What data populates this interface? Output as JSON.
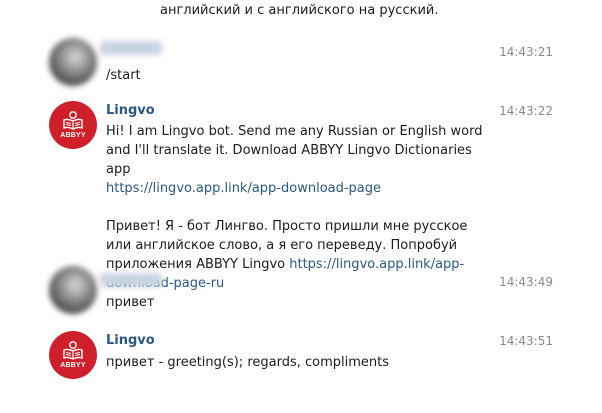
{
  "top_text": "английский и с английского на русский.",
  "messages": [
    {
      "sender": "",
      "time": "14:43:21",
      "text": "/start"
    },
    {
      "sender": "Lingvo",
      "avatar_label": "ABBYY",
      "time": "14:43:22",
      "en_text": "Hi! I am Lingvo bot. Send me any Russian or English word and I'll translate it. Download ABBYY Lingvo Dictionaries app",
      "en_link": "https://lingvo.app.link/app-download-page",
      "ru_text": "Привет! Я - бот Лингво. Просто пришли мне русское или английское слово, а я его переведу. Попробуй приложения ABBYY Lingvo",
      "ru_link": "https://lingvo.app.link/app-download-page-ru"
    },
    {
      "sender": "",
      "time": "14:43:49",
      "text": "привет"
    },
    {
      "sender": "Lingvo",
      "avatar_label": "ABBYY",
      "time": "14:43:51",
      "text": "привет - greeting(s); regards, compliments"
    }
  ],
  "colors": {
    "sender_name": "#2a5885",
    "link": "#2a5885",
    "bot_avatar": "#cf1f2b",
    "time": "#8a8a8a"
  },
  "icons": {
    "bot_avatar": "abbyy-book-logo-icon"
  }
}
